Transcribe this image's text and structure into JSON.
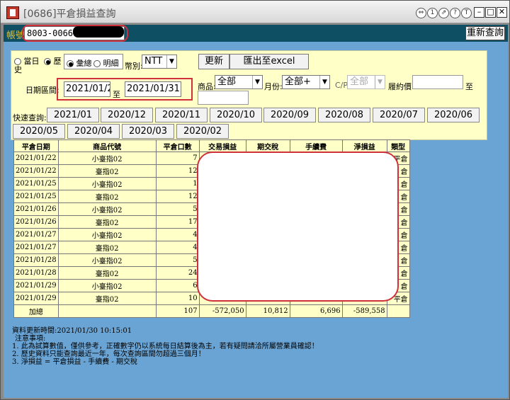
{
  "window": {
    "title": "[0686]平倉損益查詢",
    "title_buttons": [
      "⇔",
      "1",
      "⇗",
      "?",
      "T"
    ]
  },
  "account": {
    "label": "帳號",
    "value": "8003-0066",
    "refresh_label": "重新查詢"
  },
  "filter": {
    "mode_today": "當日",
    "mode_history": "歷史",
    "view_total": "彙總",
    "view_detail": "明細",
    "currency_label": "幣別:",
    "currency_value": "NTT",
    "update_label": "更新",
    "export_label": "匯出至excel",
    "date_label": "日期區間:",
    "date_from": "2021/01/2",
    "date_to_label": "至",
    "date_to": "2021/01/31",
    "product_label": "商品:",
    "product_value": "全部",
    "month_label": "月份:",
    "month_value": "全部+",
    "cp_label": "C/P",
    "cp_value": "全部",
    "strike_label": "履約價",
    "strike_to": "至",
    "quick_label": "快速查詢:",
    "quick_months": [
      "2021/01",
      "2020/12",
      "2020/11",
      "2020/10",
      "2020/09",
      "2020/08",
      "2020/07",
      "2020/06",
      "2020/05",
      "2020/04",
      "2020/03",
      "2020/02"
    ]
  },
  "table": {
    "headers": [
      "平倉日期",
      "商品代號",
      "平倉口數",
      "交易損益",
      "期交稅",
      "手續費",
      "淨損益",
      "類型"
    ],
    "rows": [
      {
        "date": "2021/01/22",
        "product": "小臺指02",
        "qty": "7",
        "type": "平倉"
      },
      {
        "date": "2021/01/22",
        "product": "臺指02",
        "qty": "12",
        "type": "倉"
      },
      {
        "date": "2021/01/25",
        "product": "小臺指02",
        "qty": "1",
        "type": "倉"
      },
      {
        "date": "2021/01/25",
        "product": "臺指02",
        "qty": "12",
        "type": "倉"
      },
      {
        "date": "2021/01/26",
        "product": "小臺指02",
        "qty": "5",
        "type": "倉"
      },
      {
        "date": "2021/01/26",
        "product": "臺指02",
        "qty": "17",
        "type": "倉"
      },
      {
        "date": "2021/01/27",
        "product": "小臺指02",
        "qty": "4",
        "type": "倉"
      },
      {
        "date": "2021/01/27",
        "product": "臺指02",
        "qty": "4",
        "type": "倉"
      },
      {
        "date": "2021/01/28",
        "product": "小臺指02",
        "qty": "5",
        "type": "倉"
      },
      {
        "date": "2021/01/28",
        "product": "臺指02",
        "qty": "24",
        "type": "倉"
      },
      {
        "date": "2021/01/29",
        "product": "小臺指02",
        "qty": "6",
        "type": "倉"
      },
      {
        "date": "2021/01/29",
        "product": "臺指02",
        "qty": "10",
        "type": "平倉"
      }
    ],
    "total": {
      "label": "加總",
      "qty": "107",
      "pnl": "-572,050",
      "tax": "10,812",
      "fee": "6,696",
      "net": "-589,558"
    }
  },
  "notes": {
    "update_time": "資料更新時間:2021/01/30 10:15:01",
    "heading": "注意事項:",
    "lines": [
      "1. 此為試算數值，僅供參考，正確數字仍以系統每日結算後為主，若有疑問請洽所屬營業員確認！",
      "2. 歷史資料只能查詢最近一年，每次查詢區間勿超過三個月！",
      "3. 淨損益 = 平倉損益 - 手續費 - 期交稅"
    ]
  }
}
